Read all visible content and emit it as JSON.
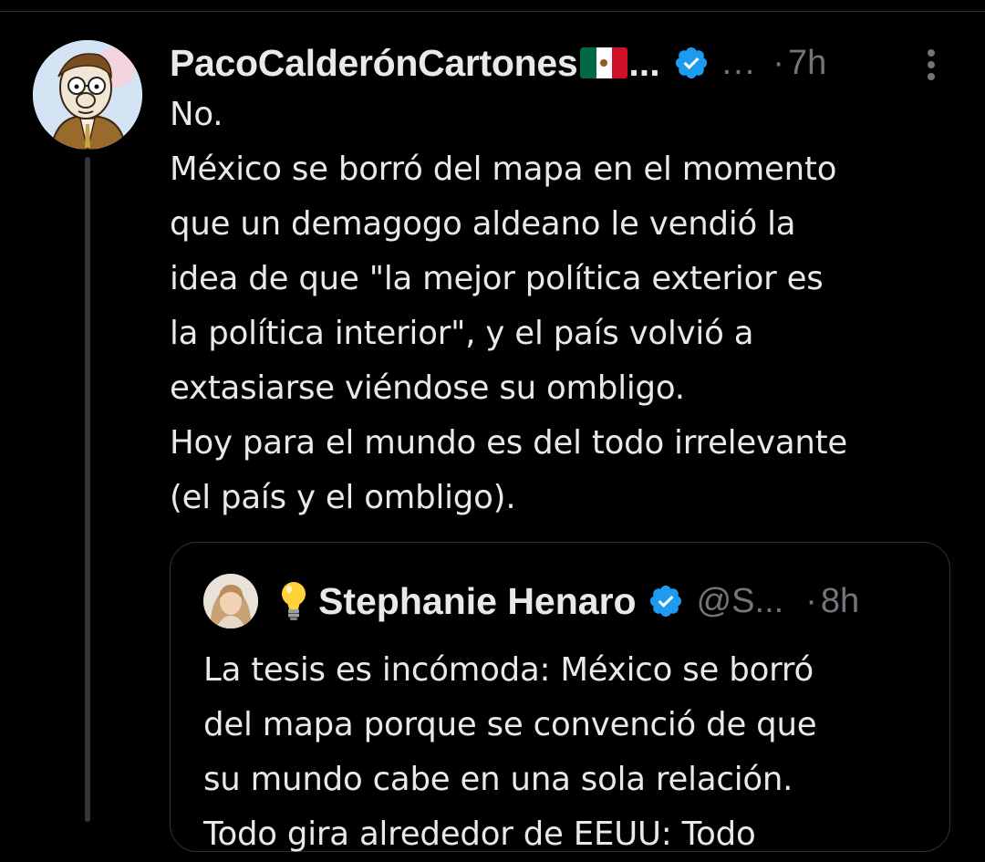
{
  "tweet": {
    "author_name": "PacoCalderónCartones",
    "name_ellipsis": "...",
    "handle": "...",
    "separator": "·",
    "time": "7h",
    "text": "No.\nMéxico se borró del mapa en el momento\nque un demagogo aldeano le vendió la\nidea de que \"la mejor política exterior es\nla política interior\", y el país volvió a\nextasiarse viéndose su ombligo.\nHoy para el mundo es del todo irrelevante\n(el país y el ombligo).",
    "icons": {
      "avatar": "cartoon-avatar",
      "flag": "mexico-flag-icon",
      "verified": "verified-badge-icon",
      "more": "more-options-icon"
    }
  },
  "quoted_tweet": {
    "author_name": "Stephanie Henaro",
    "handle": "@S...",
    "separator": "·",
    "time": "8h",
    "text": "La tesis es incómoda: México se borró\ndel mapa porque se convenció de que\nsu mundo cabe en una sola relación.\nTodo gira alrededor de EEUU: Todo",
    "icons": {
      "avatar": "photo-avatar",
      "bulb": "light-bulb-icon",
      "verified": "verified-badge-icon"
    }
  },
  "colors": {
    "background": "#000000",
    "text_primary": "#e7e9ea",
    "text_secondary": "#71767b",
    "verified_blue": "#1d9bf0",
    "border": "#2f3336"
  }
}
